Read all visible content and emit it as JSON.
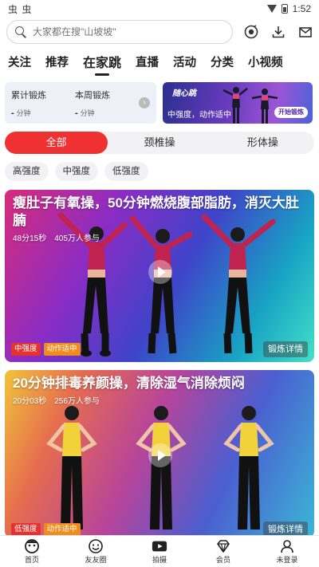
{
  "status_bar": {
    "left_glyphs": "虫 虫",
    "time": "1:52"
  },
  "search": {
    "placeholder": "大家都在搜\"山坡坡\""
  },
  "channels": [
    {
      "label": "关注"
    },
    {
      "label": "推荐"
    },
    {
      "label": "在家跳",
      "active": true
    },
    {
      "label": "直播"
    },
    {
      "label": "活动"
    },
    {
      "label": "分类"
    },
    {
      "label": "小视频"
    }
  ],
  "stats": {
    "total_label": "累计锻炼",
    "total_value": "-",
    "total_unit": "分钟",
    "week_label": "本周锻炼",
    "week_value": "-",
    "week_unit": "分钟"
  },
  "banner": {
    "logo": "随心跳",
    "subtitle": "中强度，动作适中",
    "button": "开始锻炼"
  },
  "segments": [
    {
      "label": "全部",
      "active": true
    },
    {
      "label": "颈椎操"
    },
    {
      "label": "形体操"
    }
  ],
  "chips": [
    "高强度",
    "中强度",
    "低强度"
  ],
  "videos": [
    {
      "title": "瘦肚子有氧操，50分钟燃烧腹部脂肪，消灭大肚腩",
      "duration": "48分15秒",
      "participants": "405万人参与",
      "tag_intensity": "中强度",
      "tag_motion": "动作适中",
      "detail": "锻炼详情",
      "outfit_top": "#c0234f",
      "outfit_bottom": "#111111"
    },
    {
      "title": "20分钟排毒养颜操，清除湿气消除烦闷",
      "duration": "20分03秒",
      "participants": "256万人参与",
      "tag_intensity": "低强度",
      "tag_motion": "动作适中",
      "detail": "锻炼详情",
      "outfit_top": "#f2d23a",
      "outfit_bottom": "#111111"
    }
  ],
  "bottom_nav": [
    {
      "label": "首页",
      "icon": "home-face-icon"
    },
    {
      "label": "友友圈",
      "icon": "friends-smile-icon"
    },
    {
      "label": "拍摄",
      "icon": "camera-icon"
    },
    {
      "label": "会员",
      "icon": "diamond-icon"
    },
    {
      "label": "未登录",
      "icon": "user-icon"
    }
  ],
  "colors": {
    "accent": "#ef3131",
    "tag_orange": "#f08c1c",
    "chip_bg": "#f2f2f4"
  }
}
